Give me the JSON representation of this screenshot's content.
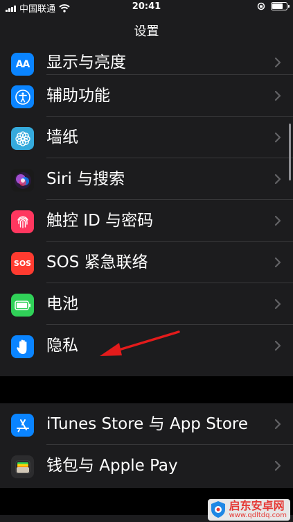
{
  "status_bar": {
    "carrier": "中国联通",
    "time": "20:41"
  },
  "nav": {
    "title": "设置"
  },
  "group1": [
    {
      "label": "显示与亮度",
      "icon": "display-brightness-icon",
      "color": "#0a84ff"
    },
    {
      "label": "辅助功能",
      "icon": "accessibility-icon",
      "color": "#0a84ff"
    },
    {
      "label": "墙纸",
      "icon": "wallpaper-flower-icon",
      "color": "#35aadc"
    },
    {
      "label": "Siri 与搜索",
      "icon": "siri-icon",
      "color": "#222222"
    },
    {
      "label": "触控 ID 与密码",
      "icon": "fingerprint-icon",
      "color": "#ff375f"
    },
    {
      "label": "SOS 紧急联络",
      "icon": "sos-icon",
      "color": "#ff3b30"
    },
    {
      "label": "电池",
      "icon": "battery-icon",
      "color": "#30d158"
    },
    {
      "label": "隐私",
      "icon": "privacy-hand-icon",
      "color": "#0a84ff"
    }
  ],
  "group2": [
    {
      "label": "iTunes Store 与 App Store",
      "icon": "app-store-icon",
      "color": "#0a84ff"
    },
    {
      "label": "钱包与 Apple Pay",
      "icon": "wallet-icon",
      "color": "#2c2c2e"
    }
  ],
  "icon_text": {
    "display": "AA",
    "sos": "SOS"
  },
  "watermark": {
    "title": "启东安卓网",
    "url": "www.qdltdq.com"
  }
}
